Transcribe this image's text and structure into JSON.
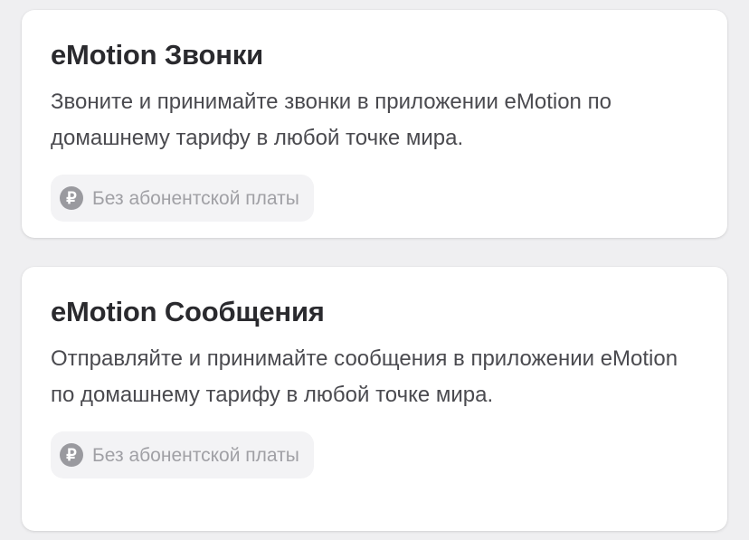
{
  "cards": [
    {
      "title": "eMotion Звонки",
      "description": "Звоните и принимайте звонки в приложении eMotion по домашнему тарифу в любой точке мира.",
      "badge": {
        "icon": "ruble-icon",
        "icon_glyph": "₽",
        "label": "Без абонентской платы"
      }
    },
    {
      "title": "eMotion Сообщения",
      "description": "Отправляйте и принимайте сообщения в приложении eMotion по домашнему тарифу в любой точке мира.",
      "badge": {
        "icon": "ruble-icon",
        "icon_glyph": "₽",
        "label": "Без абонентской платы"
      }
    }
  ]
}
